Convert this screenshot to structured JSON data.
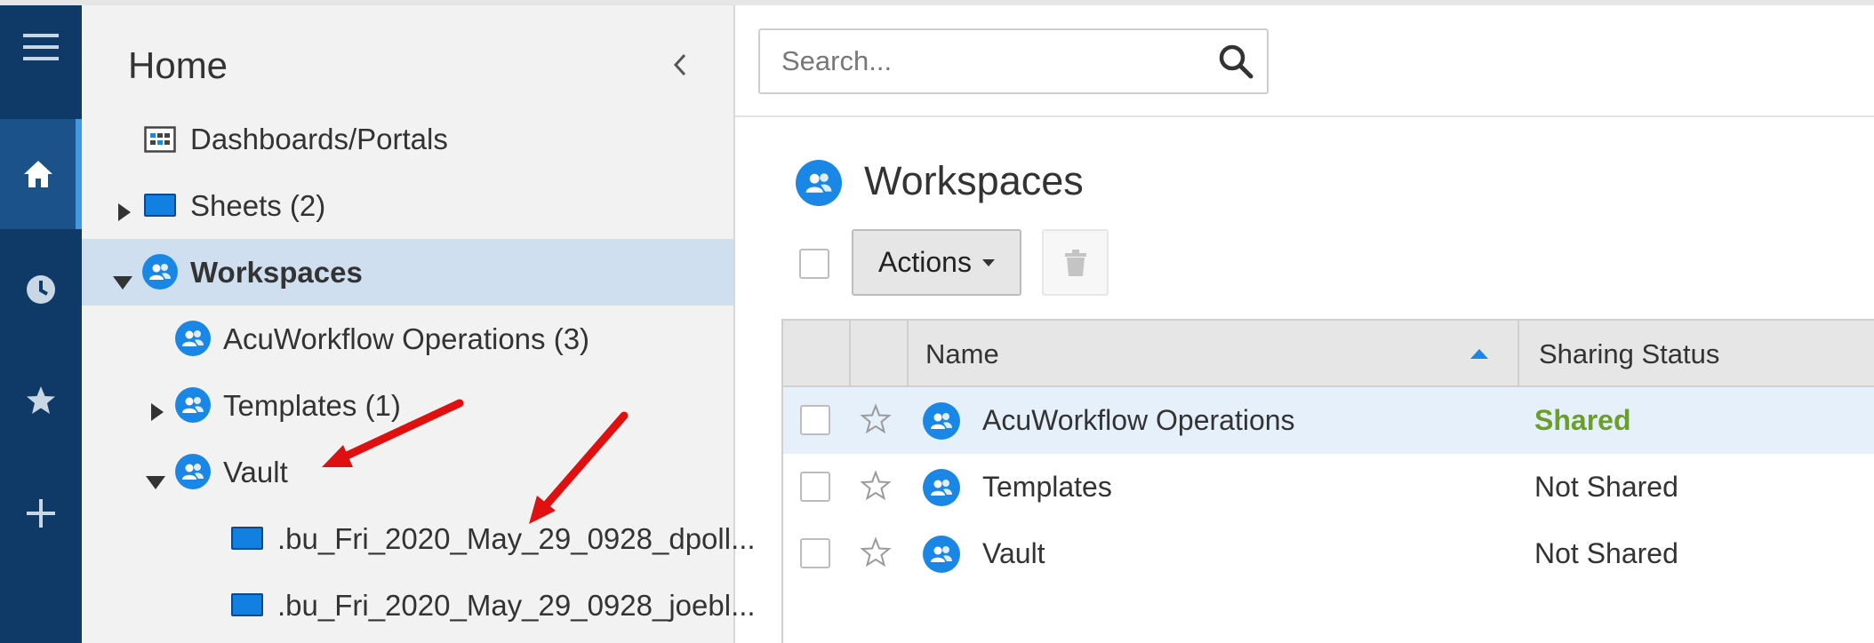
{
  "sidebar_rail": {
    "items": [
      {
        "icon": "hamburger-menu-icon"
      },
      {
        "icon": "home-icon",
        "active": true
      },
      {
        "icon": "clock-icon"
      },
      {
        "icon": "star-icon"
      },
      {
        "icon": "plus-icon"
      }
    ]
  },
  "tree": {
    "title": "Home",
    "items": [
      {
        "label": "Dashboards/Portals",
        "icon": "dashboard-icon"
      },
      {
        "label": "Sheets (2)",
        "icon": "folder-icon",
        "expanded": false
      },
      {
        "label": "Workspaces",
        "icon": "workspace-icon",
        "expanded": true,
        "selected": true
      },
      {
        "label": "AcuWorkflow Operations (3)",
        "icon": "workspace-icon"
      },
      {
        "label": "Templates (1)",
        "icon": "workspace-icon",
        "expanded": false
      },
      {
        "label": "Vault",
        "icon": "workspace-icon",
        "expanded": true
      },
      {
        "label": ".bu_Fri_2020_May_29_0928_dpoll...",
        "icon": "folder-icon"
      },
      {
        "label": ".bu_Fri_2020_May_29_0928_joebl...",
        "icon": "folder-icon"
      }
    ]
  },
  "search": {
    "placeholder": "Search..."
  },
  "main": {
    "title": "Workspaces",
    "actions_label": "Actions",
    "columns": {
      "name": "Name",
      "sharing": "Sharing Status"
    },
    "rows": [
      {
        "name": "AcuWorkflow Operations",
        "status": "Shared",
        "highlighted": true
      },
      {
        "name": "Templates",
        "status": "Not Shared"
      },
      {
        "name": "Vault",
        "status": "Not Shared"
      }
    ]
  },
  "colors": {
    "rail": "#0f3a67",
    "rail_active": "#1a5289",
    "accent_blue": "#1a87e6",
    "selected_row": "#cfdff0",
    "shared_green": "#6a9f2a",
    "annotation_red": "#e01010"
  }
}
